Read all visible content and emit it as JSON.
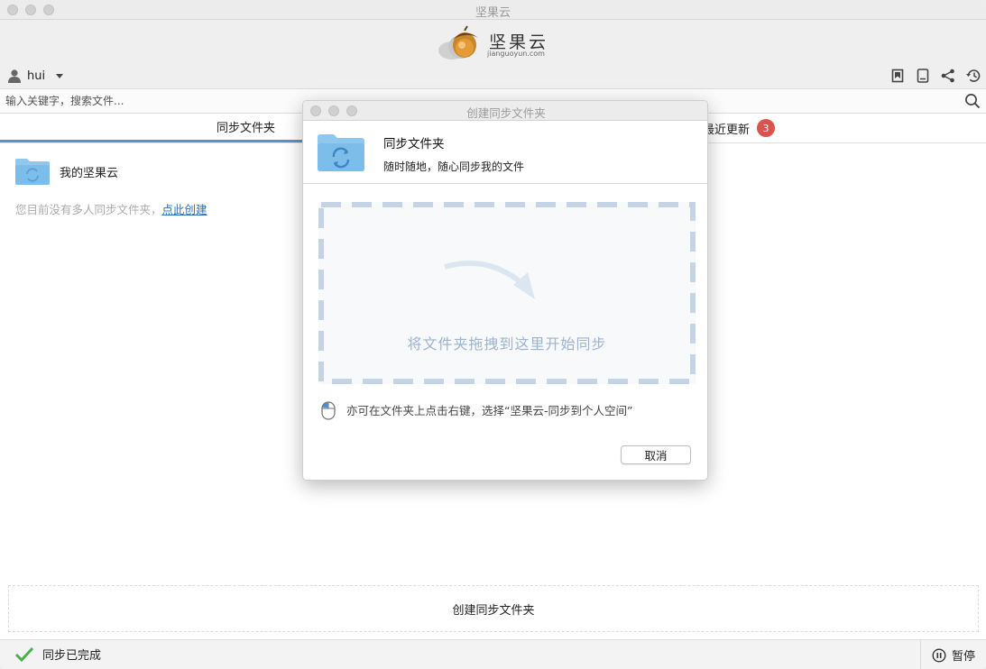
{
  "window": {
    "title": "坚果云"
  },
  "logo": {
    "name": "坚果云",
    "domain": "jianguoyun.com"
  },
  "user": {
    "name": "hui"
  },
  "search": {
    "placeholder": "输入关键字，搜索文件..."
  },
  "tabs": {
    "sync": {
      "label": "同步文件夹"
    },
    "recent": {
      "label": "最近更新",
      "badge": "3"
    }
  },
  "folders": [
    {
      "name": "我的坚果云"
    }
  ],
  "hint": {
    "text": "您目前没有多人同步文件夹，",
    "link": "点此创建"
  },
  "create_button": {
    "label": "创建同步文件夹"
  },
  "status": {
    "text": "同步已完成",
    "pause_label": "暂停"
  },
  "dialog": {
    "title": "创建同步文件夹",
    "heading": "同步文件夹",
    "subheading": "随时随地，随心同步我的文件",
    "drop_text": "将文件夹拖拽到这里开始同步",
    "tip": "亦可在文件夹上点击右键，选择“坚果云-同步到个人空间”",
    "cancel_label": "取消"
  },
  "colors": {
    "accent": "#5a93c8",
    "badge": "#d9534f",
    "folder": "#7cbdea",
    "check": "#4cae4c"
  }
}
